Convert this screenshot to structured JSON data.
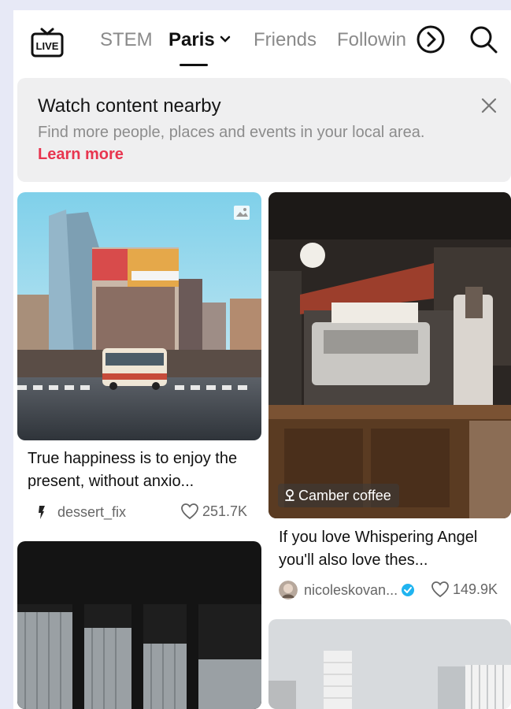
{
  "header": {
    "live_icon": "live-tv-icon",
    "live_label": "LIVE",
    "tabs": [
      {
        "label": "STEM",
        "active": false
      },
      {
        "label": "Paris",
        "active": true
      },
      {
        "label": "Friends",
        "active": false
      },
      {
        "label": "Followin",
        "active": false
      }
    ],
    "more_icon": "chevron-right-circle-icon",
    "search_icon": "search-icon"
  },
  "banner": {
    "title": "Watch content nearby",
    "description": "Find more people, places and events in your local area.",
    "link": "Learn more",
    "close_icon": "close-icon"
  },
  "feed": {
    "cards": [
      {
        "caption": "True happiness is to enjoy the present, without anxio...",
        "author": "dessert_fix",
        "likes": "251.7K",
        "image_badge": "image-icon"
      },
      {
        "location": "Camber coffee",
        "caption": "If you love Whispering Angel you'll also love thes...",
        "author": "nicoleskovan...",
        "verified": true,
        "likes": "149.9K"
      }
    ]
  },
  "colors": {
    "accent": "#e8354f",
    "verified": "#20b4f0",
    "text": "#111111",
    "muted": "#8c8c8c"
  }
}
